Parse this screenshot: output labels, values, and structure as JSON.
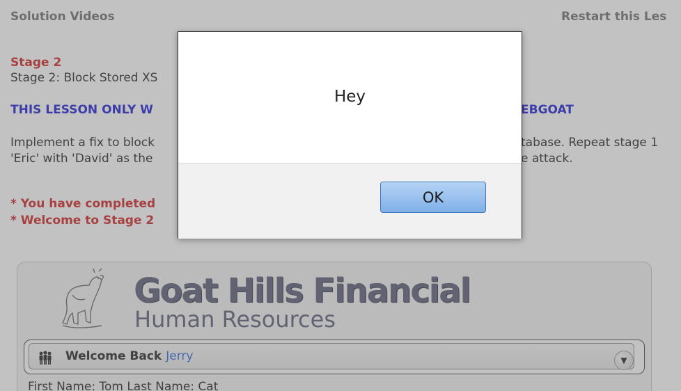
{
  "topbar": {
    "solution_videos": "Solution Videos",
    "restart_lesson": "Restart this Les"
  },
  "lesson": {
    "stage_title": "Stage 2",
    "stage_desc": "Stage 2: Block Stored XS",
    "warning_left": "THIS LESSON ONLY W",
    "warning_right": "EBGOAT",
    "impl_line1_left": "Implement a fix to block",
    "impl_line2_left": "'Eric' with 'David' as the",
    "impl_line1_right": "tabase. Repeat stage 1",
    "impl_line2_right": "e attack.",
    "msg_completed": "* You have completed",
    "msg_welcome": "* Welcome to Stage 2"
  },
  "brand": {
    "title": "Goat Hills Financial",
    "subtitle": "Human Resources"
  },
  "welcome": {
    "label": "Welcome Back",
    "user": "Jerry",
    "collapse_icon": "chevron-down-icon",
    "people_icon": "people-icon"
  },
  "employee": {
    "line": "First Name: Tom Last Name: Cat"
  },
  "dialog": {
    "message": "Hey",
    "ok_label": "OK"
  }
}
